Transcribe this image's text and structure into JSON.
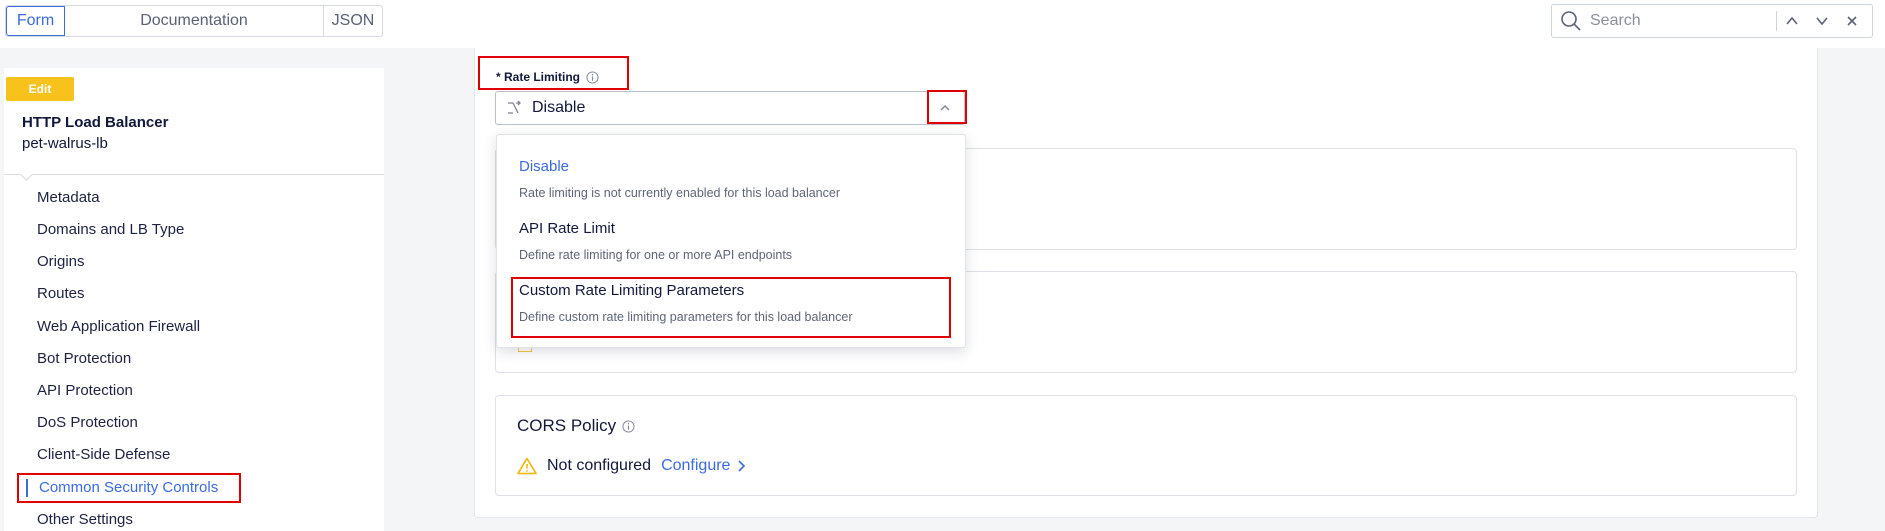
{
  "header": {
    "tabs": [
      {
        "label": "Form",
        "active": true
      },
      {
        "label": "Documentation",
        "active": false
      },
      {
        "label": "JSON",
        "active": false
      }
    ],
    "search": {
      "placeholder": "Search"
    }
  },
  "sidebar": {
    "badge": "Edit",
    "lb_type": "HTTP Load Balancer",
    "lb_name": "pet-walrus-lb",
    "items": [
      {
        "label": "Metadata"
      },
      {
        "label": "Domains and LB Type"
      },
      {
        "label": "Origins"
      },
      {
        "label": "Routes"
      },
      {
        "label": "Web Application Firewall"
      },
      {
        "label": "Bot Protection"
      },
      {
        "label": "API Protection"
      },
      {
        "label": "DoS Protection"
      },
      {
        "label": "Client-Side Defense"
      },
      {
        "label": "Common Security Controls",
        "active": true
      },
      {
        "label": "Other Settings"
      }
    ]
  },
  "main": {
    "rate_limiting": {
      "label": "* Rate Limiting",
      "selected": "Disable",
      "options": [
        {
          "title": "Disable",
          "desc": "Rate limiting is not currently enabled for this load balancer",
          "selected": true
        },
        {
          "title": "API Rate Limit",
          "desc": "Define rate limiting for one or more API endpoints"
        },
        {
          "title": "Custom Rate Limiting Parameters",
          "desc": "Define custom rate limiting parameters for this load balancer"
        }
      ]
    },
    "cors": {
      "title": "CORS Policy",
      "status": "Not configured",
      "action": "Configure"
    }
  },
  "colors": {
    "accent": "#3c6be0",
    "badge": "#f6c21b",
    "warning": "#f2b600",
    "highlight": "#e00000"
  }
}
